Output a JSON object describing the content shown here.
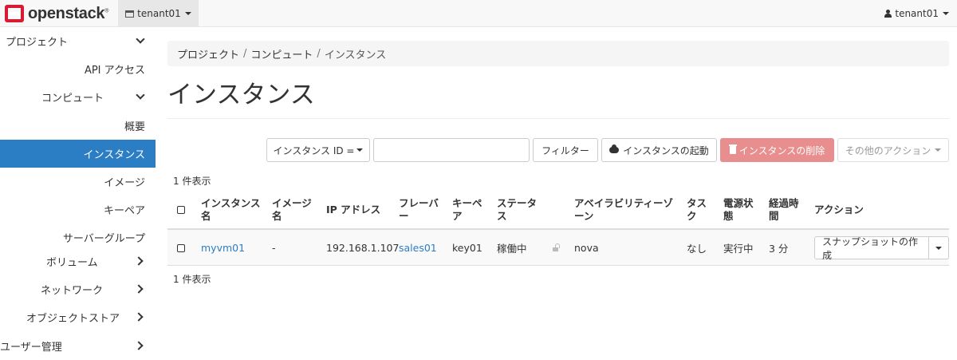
{
  "brand": {
    "name": "openstack",
    "trademark": "®",
    "logo_color": "#da1a32"
  },
  "header": {
    "project_selector": "tenant01",
    "user_menu": "tenant01"
  },
  "sidebar": {
    "items": [
      {
        "label": "プロジェクト",
        "chevron": "down"
      },
      {
        "label": "API アクセス"
      },
      {
        "label": "コンピュート",
        "chevron": "down"
      },
      {
        "label": "概要"
      },
      {
        "label": "インスタンス",
        "active": true
      },
      {
        "label": "イメージ"
      },
      {
        "label": "キーペア"
      },
      {
        "label": "サーバーグループ"
      },
      {
        "label": "ボリューム",
        "chevron": "right"
      },
      {
        "label": "ネットワーク",
        "chevron": "right"
      },
      {
        "label": "オブジェクトストア",
        "chevron": "right"
      },
      {
        "label": "ユーザー管理",
        "chevron": "right"
      }
    ],
    "active_color": "#2b7dc4"
  },
  "breadcrumb": {
    "items": [
      "プロジェクト",
      "コンピュート",
      "インスタンス"
    ],
    "separator": "/"
  },
  "page_title": "インスタンス",
  "toolbar": {
    "filter_field": "インスタンス ID =",
    "filter_value": "",
    "filter_button": "フィルター",
    "launch_button": "インスタンスの起動",
    "delete_button": "インスタンスの削除",
    "more_actions": "その他のアクション"
  },
  "count_top": "1 件表示",
  "count_bottom": "1 件表示",
  "table": {
    "headers": {
      "name": "インスタンス名",
      "image": "イメージ名",
      "ip": "IP アドレス",
      "flavor": "フレーバー",
      "keypair": "キーペア",
      "status": "ステータス",
      "az": "アベイラビリティーゾーン",
      "task": "タスク",
      "power": "電源状態",
      "age": "経過時間",
      "actions": "アクション"
    },
    "rows": [
      {
        "name": "myvm01",
        "image": "-",
        "ip": "192.168.1.107",
        "flavor": "sales01",
        "keypair": "key01",
        "status": "稼働中",
        "az": "nova",
        "task": "なし",
        "power": "実行中",
        "age": "3 分",
        "action": "スナップショットの作成"
      }
    ]
  }
}
